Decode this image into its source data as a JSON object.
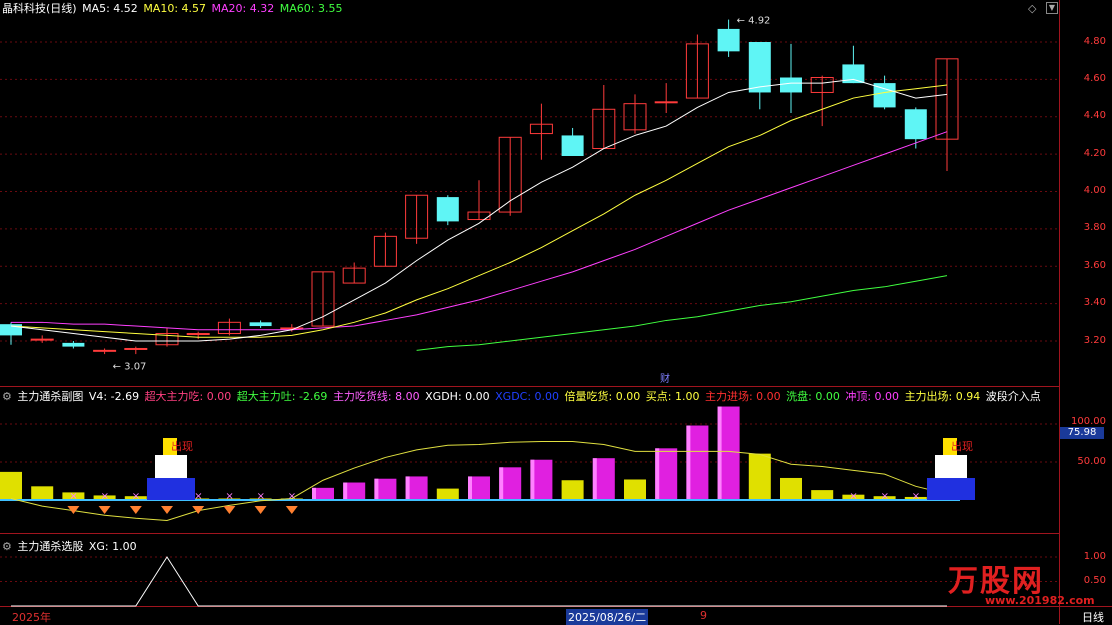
{
  "header": {
    "stock": "晶科科技(日线)",
    "ma5": "MA5: 4.52",
    "ma10": "MA10: 4.57",
    "ma20": "MA20: 4.32",
    "ma60": "MA60: 3.55"
  },
  "main_axis": [
    "4.80",
    "4.60",
    "4.40",
    "4.20",
    "4.00",
    "3.80",
    "3.60",
    "3.40",
    "3.20"
  ],
  "annotations": {
    "high": "4.92",
    "low": "3.07",
    "cai": "财"
  },
  "sub1": {
    "title": "主力通杀副图",
    "v4": "V4: -2.69",
    "chaoda_chi": "超大主力吃: 0.00",
    "chaoda_tu": "超大主力吐: -2.69",
    "chihuo_xian": "主力吃货线: 8.00",
    "xgdh": "XGDH: 0.00",
    "xgdc": "XGDC: 0.00",
    "beiliang": "倍量吃货: 0.00",
    "maidian": "买点: 1.00",
    "jinchang": "主力进场: 0.00",
    "xipan": "洗盘: 0.00",
    "chongding": "冲顶: 0.00",
    "chuchang": "主力出场: 0.94",
    "boduan": "波段介入点",
    "axis_100": "100.00",
    "axis_50": "50.00",
    "value_box": "75.98",
    "label_left": "出现",
    "label_right": "出现"
  },
  "sub2": {
    "title": "主力通杀选股",
    "xg": "XG: 1.00",
    "axis_1": "1.00",
    "axis_05": "0.50"
  },
  "footer": {
    "year": "2025年",
    "date": "2025/08/26/二",
    "num": "9",
    "period": "日线"
  },
  "watermark": {
    "brand": "万股网",
    "url": "www.201982.com"
  },
  "colors": {
    "up": "#ff3b3b",
    "down": "#5ff5f5",
    "ma5": "#ffffff",
    "ma10": "#ffff40",
    "ma20": "#ff40ff",
    "ma60": "#40ff40"
  },
  "candles": [
    {
      "o": 3.29,
      "c": 3.23,
      "h": 3.3,
      "l": 3.18
    },
    {
      "o": 3.21,
      "c": 3.21,
      "h": 3.23,
      "l": 3.19
    },
    {
      "o": 3.19,
      "c": 3.17,
      "h": 3.2,
      "l": 3.16
    },
    {
      "o": 3.15,
      "c": 3.15,
      "h": 3.16,
      "l": 3.13
    },
    {
      "o": 3.16,
      "c": 3.16,
      "h": 3.17,
      "l": 3.13
    },
    {
      "o": 3.18,
      "c": 3.24,
      "h": 3.27,
      "l": 3.17
    },
    {
      "o": 3.24,
      "c": 3.24,
      "h": 3.25,
      "l": 3.21
    },
    {
      "o": 3.24,
      "c": 3.3,
      "h": 3.32,
      "l": 3.23
    },
    {
      "o": 3.3,
      "c": 3.28,
      "h": 3.31,
      "l": 3.27
    },
    {
      "o": 3.27,
      "c": 3.27,
      "h": 3.29,
      "l": 3.25
    },
    {
      "o": 3.28,
      "c": 3.57,
      "h": 3.57,
      "l": 3.28
    },
    {
      "o": 3.51,
      "c": 3.59,
      "h": 3.62,
      "l": 3.51
    },
    {
      "o": 3.6,
      "c": 3.76,
      "h": 3.78,
      "l": 3.6
    },
    {
      "o": 3.75,
      "c": 3.98,
      "h": 3.98,
      "l": 3.72
    },
    {
      "o": 3.97,
      "c": 3.84,
      "h": 3.98,
      "l": 3.82
    },
    {
      "o": 3.85,
      "c": 3.89,
      "h": 4.06,
      "l": 3.85
    },
    {
      "o": 3.89,
      "c": 4.29,
      "h": 4.29,
      "l": 3.87
    },
    {
      "o": 4.31,
      "c": 4.36,
      "h": 4.47,
      "l": 4.17
    },
    {
      "o": 4.3,
      "c": 4.19,
      "h": 4.34,
      "l": 4.19
    },
    {
      "o": 4.23,
      "c": 4.44,
      "h": 4.57,
      "l": 4.23
    },
    {
      "o": 4.33,
      "c": 4.47,
      "h": 4.52,
      "l": 4.31
    },
    {
      "o": 4.48,
      "c": 4.48,
      "h": 4.58,
      "l": 4.42
    },
    {
      "o": 4.5,
      "c": 4.79,
      "h": 4.84,
      "l": 4.5
    },
    {
      "o": 4.87,
      "c": 4.75,
      "h": 4.92,
      "l": 4.72
    },
    {
      "o": 4.8,
      "c": 4.53,
      "h": 4.8,
      "l": 4.44
    },
    {
      "o": 4.61,
      "c": 4.53,
      "h": 4.79,
      "l": 4.42
    },
    {
      "o": 4.53,
      "c": 4.61,
      "h": 4.62,
      "l": 4.35
    },
    {
      "o": 4.68,
      "c": 4.58,
      "h": 4.78,
      "l": 4.58
    },
    {
      "o": 4.58,
      "c": 4.45,
      "h": 4.62,
      "l": 4.44
    },
    {
      "o": 4.44,
      "c": 4.28,
      "h": 4.45,
      "l": 4.23
    },
    {
      "o": 4.28,
      "c": 4.71,
      "h": 4.71,
      "l": 4.11
    }
  ],
  "ma5_line": [
    3.28,
    3.26,
    3.24,
    3.22,
    3.2,
    3.2,
    3.2,
    3.21,
    3.23,
    3.26,
    3.33,
    3.42,
    3.51,
    3.63,
    3.74,
    3.83,
    3.95,
    4.05,
    4.13,
    4.23,
    4.3,
    4.35,
    4.45,
    4.53,
    4.56,
    4.58,
    4.58,
    4.6,
    4.55,
    4.5,
    4.52
  ],
  "ma10_line": [
    3.28,
    3.27,
    3.26,
    3.25,
    3.24,
    3.23,
    3.22,
    3.22,
    3.22,
    3.23,
    3.26,
    3.3,
    3.35,
    3.42,
    3.48,
    3.55,
    3.62,
    3.7,
    3.79,
    3.88,
    3.98,
    4.06,
    4.15,
    4.24,
    4.3,
    4.38,
    4.44,
    4.5,
    4.53,
    4.55,
    4.57
  ],
  "ma20_line": [
    3.3,
    3.3,
    3.29,
    3.29,
    3.28,
    3.27,
    3.26,
    3.26,
    3.26,
    3.26,
    3.27,
    3.28,
    3.31,
    3.34,
    3.38,
    3.42,
    3.47,
    3.52,
    3.57,
    3.63,
    3.69,
    3.76,
    3.83,
    3.9,
    3.96,
    4.02,
    4.08,
    4.14,
    4.2,
    4.26,
    4.32
  ],
  "ma60_line": [
    null,
    null,
    null,
    null,
    null,
    null,
    null,
    null,
    null,
    null,
    null,
    null,
    null,
    3.15,
    3.17,
    3.18,
    3.2,
    3.22,
    3.24,
    3.26,
    3.28,
    3.31,
    3.33,
    3.36,
    3.39,
    3.41,
    3.44,
    3.47,
    3.49,
    3.52,
    3.55
  ],
  "sub1_bars": [
    {
      "v": 37,
      "c": "y"
    },
    {
      "v": 18,
      "c": "y"
    },
    {
      "v": 10,
      "c": "y"
    },
    {
      "v": 6,
      "c": "y"
    },
    {
      "v": 5,
      "c": "y"
    },
    {
      "v": 3,
      "c": "y"
    },
    {
      "v": 2,
      "c": "y"
    },
    {
      "v": 2,
      "c": "y"
    },
    {
      "v": 2,
      "c": "y"
    },
    {
      "v": 2,
      "c": "y"
    },
    {
      "v": 16,
      "c": "m"
    },
    {
      "v": 23,
      "c": "m"
    },
    {
      "v": 28,
      "c": "m"
    },
    {
      "v": 31,
      "c": "m"
    },
    {
      "v": 15,
      "c": "y"
    },
    {
      "v": 31,
      "c": "m"
    },
    {
      "v": 43,
      "c": "m"
    },
    {
      "v": 53,
      "c": "m"
    },
    {
      "v": 26,
      "c": "y"
    },
    {
      "v": 55,
      "c": "m"
    },
    {
      "v": 27,
      "c": "y"
    },
    {
      "v": 68,
      "c": "m"
    },
    {
      "v": 98,
      "c": "m"
    },
    {
      "v": 123,
      "c": "m"
    },
    {
      "v": 61,
      "c": "y"
    },
    {
      "v": 29,
      "c": "y"
    },
    {
      "v": 13,
      "c": "y"
    },
    {
      "v": 7,
      "c": "y"
    },
    {
      "v": 5,
      "c": "y"
    },
    {
      "v": 4,
      "c": "y"
    },
    {
      "v": 2,
      "c": "y"
    }
  ],
  "sub1_line": [
    2,
    -8,
    -14,
    -20,
    -24,
    -27,
    -14,
    -7,
    -1,
    2,
    26,
    42,
    56,
    66,
    72,
    73,
    76,
    77,
    77,
    73,
    64,
    64,
    64,
    64,
    60,
    47,
    44,
    39,
    34,
    18,
    8
  ],
  "sub2_xg": [
    0,
    0,
    0,
    0,
    0,
    1,
    0,
    0,
    0,
    0,
    0,
    0,
    0,
    0,
    0,
    0,
    0,
    0,
    0,
    0,
    0,
    0,
    0,
    0,
    0,
    0,
    0,
    0,
    0,
    0,
    0
  ]
}
